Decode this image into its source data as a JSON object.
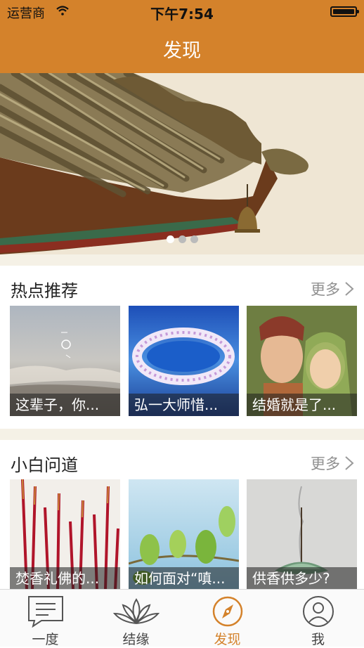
{
  "status_bar": {
    "carrier": "运营商",
    "time": "下午7:54"
  },
  "nav": {
    "title": "发现"
  },
  "banner": {
    "image": "temple-roof-with-bell",
    "dots": 3,
    "active_index": 0
  },
  "hot": {
    "title": "热点推荐",
    "more": "更多",
    "items": [
      {
        "caption": "这辈子，你...",
        "image": "misty-sky-calligraphy"
      },
      {
        "caption": "弘一大师惜...",
        "image": "water-flower-ring"
      },
      {
        "caption": "结婚就是了...",
        "image": "painted-guanyin-couple"
      }
    ]
  },
  "qa": {
    "title": "小白问道",
    "more": "更多",
    "items": [
      {
        "caption": "焚香礼佛的...",
        "image": "red-incense-sticks"
      },
      {
        "caption": "如何面对“嗔...",
        "image": "green-leaves-sky"
      },
      {
        "caption": "供香供多少?",
        "image": "incense-on-lotus"
      }
    ]
  },
  "tabs": [
    {
      "label": "一度",
      "icon": "chat-bubble-icon",
      "active": false
    },
    {
      "label": "结缘",
      "icon": "lotus-icon",
      "active": false
    },
    {
      "label": "发现",
      "icon": "compass-icon",
      "active": true
    },
    {
      "label": "我",
      "icon": "person-icon",
      "active": false
    }
  ],
  "colors": {
    "accent": "#D4822B",
    "band": "#F5F1E6"
  }
}
